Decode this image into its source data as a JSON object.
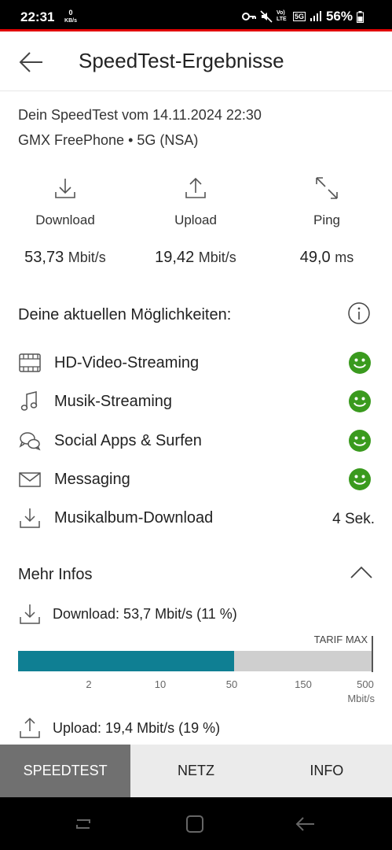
{
  "status_bar": {
    "time": "22:31",
    "net_speed_value": "0",
    "net_speed_unit": "KB/s",
    "battery": "56%",
    "network_label": "5G",
    "volte_label": "Vo) LTE"
  },
  "header": {
    "title": "SpeedTest-Ergebnisse",
    "back_icon": "arrow-left-icon"
  },
  "summary": {
    "date_line": "Dein SpeedTest vom 14.11.2024 22:30",
    "provider_line": "GMX FreePhone • 5G (NSA)"
  },
  "metrics": [
    {
      "label": "Download",
      "value": "53,73",
      "unit": "Mbit/s",
      "icon": "download-icon"
    },
    {
      "label": "Upload",
      "value": "19,42",
      "unit": "Mbit/s",
      "icon": "upload-icon"
    },
    {
      "label": "Ping",
      "value": "49,0",
      "unit": "ms",
      "icon": "ping-arrows-icon"
    }
  ],
  "capabilities": {
    "title": "Deine aktuellen Möglichkeiten:",
    "items": [
      {
        "label": "HD-Video-Streaming",
        "icon": "film-icon",
        "status": "ok"
      },
      {
        "label": "Musik-Streaming",
        "icon": "music-note-icon",
        "status": "ok"
      },
      {
        "label": "Social Apps & Surfen",
        "icon": "chat-bubbles-icon",
        "status": "ok"
      },
      {
        "label": "Messaging",
        "icon": "envelope-icon",
        "status": "ok"
      },
      {
        "label": "Musikalbum-Download",
        "icon": "download-icon",
        "value": "4 Sek."
      }
    ],
    "ok_color": "#3a9a1e"
  },
  "more_info": {
    "title": "Mehr Infos",
    "download_line": "Download: 53,7 Mbit/s (11 %)",
    "tarif_label": "TARIF MAX",
    "bar_fill_fraction": 0.61,
    "bar_color": "#0f7f93",
    "ticks": [
      "2",
      "10",
      "50",
      "150",
      "500"
    ],
    "unit_label": "Mbit/s",
    "upload_line": "Upload: 19,4 Mbit/s (19 %)"
  },
  "tabs": [
    {
      "label": "SPEEDTEST",
      "active": true
    },
    {
      "label": "NETZ",
      "active": false
    },
    {
      "label": "INFO",
      "active": false
    }
  ]
}
